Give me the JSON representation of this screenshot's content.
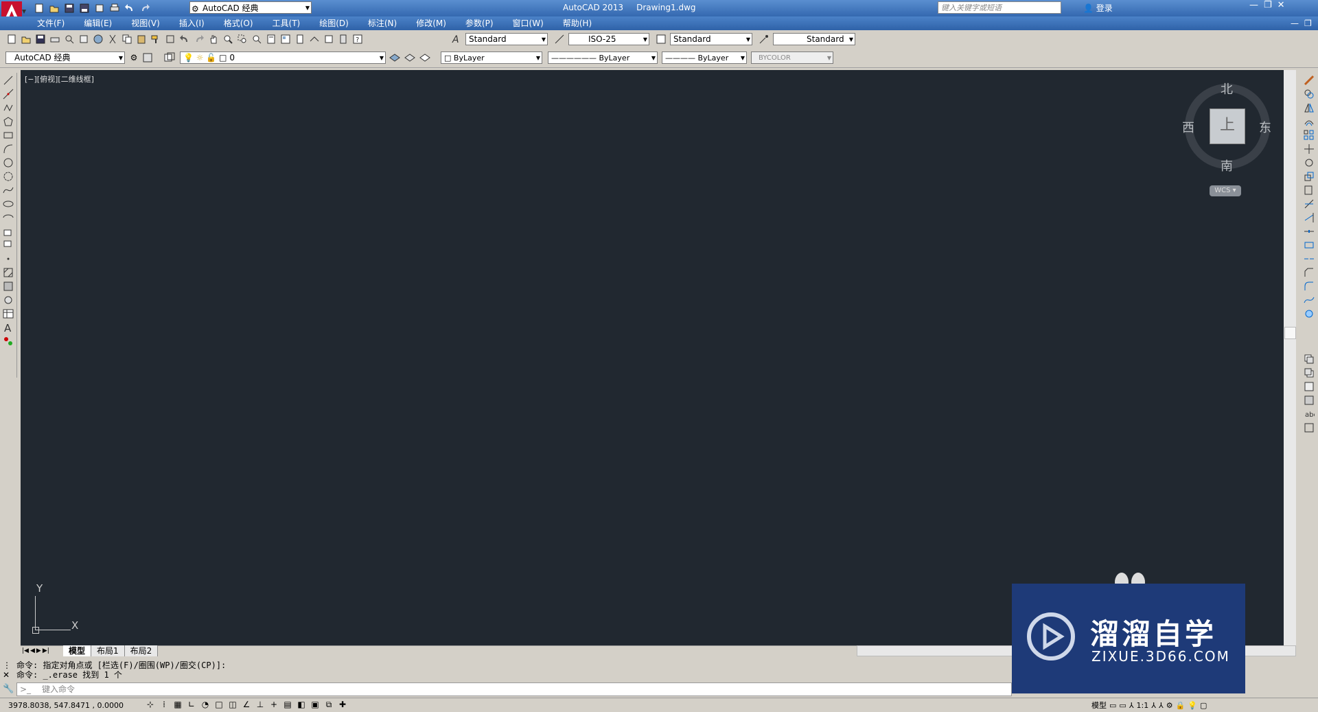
{
  "app": {
    "title": "AutoCAD 2013",
    "document": "Drawing1.dwg",
    "workspace": "AutoCAD 经典",
    "search_placeholder": "键入关键字或短语",
    "login": "登录"
  },
  "menu": [
    "文件(F)",
    "编辑(E)",
    "视图(V)",
    "插入(I)",
    "格式(O)",
    "工具(T)",
    "绘图(D)",
    "标注(N)",
    "修改(M)",
    "参数(P)",
    "窗口(W)",
    "帮助(H)"
  ],
  "styles": {
    "text_style": "Standard",
    "dim_style": "ISO-25",
    "table_style": "Standard",
    "multileader_style": "Standard"
  },
  "layers": {
    "workspace": "AutoCAD 经典",
    "current_layer": "0",
    "color": "ByLayer",
    "linetype": "ByLayer",
    "lineweight": "ByLayer",
    "plotstyle": "BYCOLOR"
  },
  "viewport": {
    "label": "[−][俯视][二维线框]",
    "compass": {
      "north": "北",
      "south": "南",
      "east": "东",
      "west": "西",
      "top": "上"
    },
    "wcs": "WCS",
    "ucs_x": "X",
    "ucs_y": "Y"
  },
  "tabs": [
    "模型",
    "布局1",
    "布局2"
  ],
  "command": {
    "line1": "命令: 指定对角点或 [栏选(F)/圈围(WP)/圈交(CP)]:",
    "line2": "命令: _.erase 找到 1 个",
    "input_placeholder": "键入命令"
  },
  "status": {
    "coords": "3978.8038, 547.8471 , 0.0000",
    "model": "模型",
    "scale": "1:1"
  },
  "watermark": {
    "cn": "溜溜自学",
    "en": "ZIXUE.3D66.COM"
  },
  "colors": {
    "canvas": "#212830",
    "titlebar": "#3468b0"
  }
}
